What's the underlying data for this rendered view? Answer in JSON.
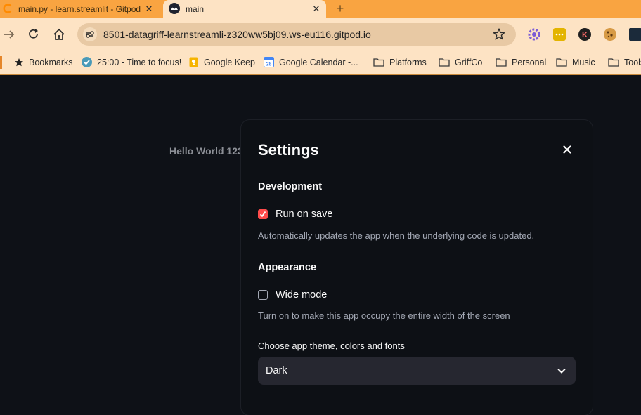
{
  "browser": {
    "tabs": [
      {
        "title": "main.py - learn.streamlit - Gitpod",
        "active": false
      },
      {
        "title": "main",
        "active": true
      }
    ],
    "url": "8501-datagriff-learnstreamli-z320ww5bj09.ws-eu116.gitpod.io",
    "bookmarks": [
      {
        "label": "Bookmarks",
        "icon": "star-icon"
      },
      {
        "label": "25:00 - Time to focus!",
        "icon": "check-circle-icon"
      },
      {
        "label": "Google Keep",
        "icon": "keep-icon"
      },
      {
        "label": "Google Calendar -...",
        "icon": "calendar-icon"
      },
      {
        "label": "Platforms",
        "icon": "folder-icon"
      },
      {
        "label": "GriffCo",
        "icon": "folder-icon"
      },
      {
        "label": "Personal",
        "icon": "folder-icon"
      },
      {
        "label": "Music",
        "icon": "folder-icon"
      },
      {
        "label": "Tools",
        "icon": "folder-icon"
      }
    ],
    "colors": {
      "frame": "#f9a441",
      "toolbar": "#fde3c4",
      "omnibox": "#e8c9a4"
    }
  },
  "app": {
    "body_text": "Hello World 123",
    "settings": {
      "title": "Settings",
      "development": {
        "heading": "Development",
        "run_on_save": {
          "label": "Run on save",
          "checked": true
        },
        "help": "Automatically updates the app when the underlying code is updated."
      },
      "appearance": {
        "heading": "Appearance",
        "wide_mode": {
          "label": "Wide mode",
          "checked": false
        },
        "help": "Turn on to make this app occupy the entire width of the screen"
      },
      "theme": {
        "label": "Choose app theme, colors and fonts",
        "selected": "Dark"
      }
    },
    "colors": {
      "background": "#0e1117",
      "accent": "#ff4b4b",
      "select_bg": "#262730"
    }
  }
}
